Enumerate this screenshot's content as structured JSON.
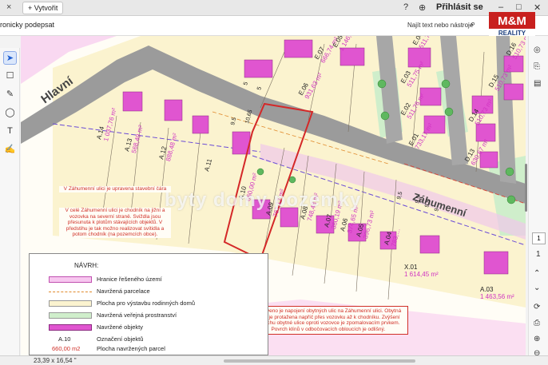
{
  "tabbar": {
    "close_symbol": "×",
    "new_tab_label": "+  Vytvořit",
    "help_symbol": "?",
    "globe_symbol": "⊕",
    "login_label": "Přihlásit se"
  },
  "toolbar": {
    "doc_title": "ronicky podepsat",
    "find_label": "Najít text nebo nástroje",
    "search_symbol": "⌕"
  },
  "tools": [
    "select-arrow-icon",
    "comment-icon",
    "pen-icon",
    "lasso-icon",
    "text-box-icon",
    "signature-icon"
  ],
  "right_panel": {
    "page_current": "1",
    "page_total": "1"
  },
  "statusbar": {
    "size_label": "23,39 x 16,54 \""
  },
  "logo": {
    "top_text": "M&M",
    "bottom_text": "REALITY"
  },
  "watermark": "byty domy pozemky",
  "map": {
    "street_hlavni": "Hlavní",
    "street_zahumenni": "Záhumenní",
    "plots": [
      {
        "id": "E.07",
        "area": "666,74 m²"
      },
      {
        "id": "E.06",
        "area": "931,63 m²"
      },
      {
        "id": "E.05",
        "area": "1 146,…"
      },
      {
        "id": "E.04",
        "area": "511,75 m²"
      },
      {
        "id": "E.03",
        "area": "511,75 m²"
      },
      {
        "id": "E.02",
        "area": "511,76 m²"
      },
      {
        "id": "E.01",
        "area": "733,17 m²"
      },
      {
        "id": "D.16",
        "area": "510,73 m²"
      },
      {
        "id": "D.15",
        "area": "510,73 m²"
      },
      {
        "id": "D.14",
        "area": "510,73 m²"
      },
      {
        "id": "D.13",
        "area": "630,67 m²"
      },
      {
        "id": "A.14",
        "area": "1 037,76 m²"
      },
      {
        "id": "A.13",
        "area": "568,49 m²"
      },
      {
        "id": "A.12",
        "area": "888,48 m²"
      },
      {
        "id": "A.11",
        "area": ""
      },
      {
        "id": "A.10",
        "area": "660,00 m²"
      },
      {
        "id": "A.09",
        "area": "767,17 m²"
      },
      {
        "id": "A.08",
        "area": "748,48 m²"
      },
      {
        "id": "A.07",
        "area": "380,19 m²"
      },
      {
        "id": "A.06",
        "area": "374,65 m²"
      },
      {
        "id": "A.05",
        "area": "396,73 m²"
      },
      {
        "id": "A.04",
        "area": "783,…"
      },
      {
        "id": "A.03",
        "area": "1 463,56 m²"
      },
      {
        "id": "X.01",
        "area": "1 614,45 m²"
      }
    ],
    "dims": [
      "5",
      "5",
      "9.5",
      "10,65",
      "9,5",
      "9,5",
      "9,5",
      "9"
    ]
  },
  "notes": {
    "note1": "V Záhumenní ulici je upravena stavební čára",
    "note2": "V celé Záhumenní ulici je chodník na jižní a vozovka na severní straně. Sviždla jsou přesunuta k plotům stávajících objektů. V předstihu je tak možno realizovat svítidla a potom chodník (na pozemcích obce).",
    "note3": "Upraveno je napojení obytných ulic na Záhumenní ulici. Obytná ulice je protažena napříč přes vozovku až k chodníku. Zvýšení povrchu obytné ulice oproti vozovce je zpomalovacím prvkem. Povrch klínů v odbočovacích obloucích je odlišný."
  },
  "legend": {
    "title": "NÁVRH:",
    "items": [
      "Hranice řešeného území",
      "Navržená parcelace",
      "Plocha pro výstavbu rodinných domů",
      "Navržená veřejná prostranství",
      "Navržené objekty",
      "Označení objektů",
      "Plocha navržených parcel"
    ],
    "sample_id": "A.10",
    "sample_area": "660,00 m2"
  },
  "colors": {
    "road": "#9b9b9b",
    "plot_fill": "#fbf3cf",
    "building": "#e055d0",
    "green": "#cfeecb",
    "boundary": "#ec77e0",
    "highlight": "#d42828",
    "note_text": "#d03028"
  }
}
